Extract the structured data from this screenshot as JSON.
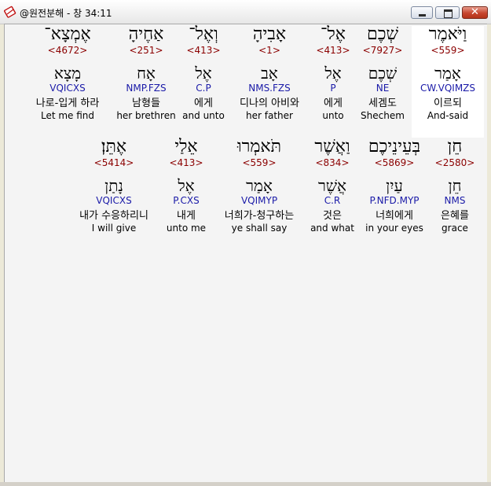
{
  "window": {
    "title": "@원전분해 - 창 34:11",
    "close_glyph": "✕"
  },
  "rows": [
    {
      "words": [
        {
          "hebrew": "וַיֹּאמֶר",
          "strong": "<559>",
          "lemma": "אָמַר",
          "morph": "CW.VQIMZS",
          "korean": "이르되",
          "english": "And-said"
        },
        {
          "hebrew": "שְׁכֶם",
          "strong": "<7927>",
          "lemma": "שְׁכֶם",
          "morph": "NE",
          "korean": "세겜도",
          "english": "Shechem"
        },
        {
          "hebrew": "אֶל־",
          "strong": "<413>",
          "lemma": "אֶל",
          "morph": "P",
          "korean": "에게",
          "english": "unto"
        },
        {
          "hebrew": "אָבִיהָ",
          "strong": "<1>",
          "lemma": "אָב",
          "morph": "NMS.FZS",
          "korean": "디나의 아비와",
          "english": "her father"
        },
        {
          "hebrew": "וְאֶל־",
          "strong": "<413>",
          "lemma": "אֶל",
          "morph": "C.P",
          "korean": "에게",
          "english": "and unto"
        },
        {
          "hebrew": "אַחֶיהָ",
          "strong": "<251>",
          "lemma": "אָח",
          "morph": "NMP.FZS",
          "korean": "남형들",
          "english": "her brethren"
        },
        {
          "hebrew": "אֶמְצָא־",
          "strong": "<4672>",
          "lemma": "מָצָא",
          "morph": "VQICXS",
          "korean": "나로-입게 하라",
          "english": "Let me find"
        }
      ]
    },
    {
      "words": [
        {
          "hebrew": "חֵן",
          "strong": "<2580>",
          "lemma": "חֵן",
          "morph": "NMS",
          "korean": "은혜를",
          "english": "grace"
        },
        {
          "hebrew": "בְּעֵינֵיכֶם",
          "strong": "<5869>",
          "lemma": "עַיִן",
          "morph": "P.NFD.MYP",
          "korean": "너희에게",
          "english": "in your eyes"
        },
        {
          "hebrew": "וַאֲשֶׁר",
          "strong": "<834>",
          "lemma": "אֲשֶׁר",
          "morph": "C.R",
          "korean": "것은",
          "english": "and what"
        },
        {
          "hebrew": "תֹּאמְרוּ",
          "strong": "<559>",
          "lemma": "אָמַר",
          "morph": "VQIMYP",
          "korean": "너희가-청구하는",
          "english": "ye shall say"
        },
        {
          "hebrew": "אֵלַי",
          "strong": "<413>",
          "lemma": "אֶל",
          "morph": "P.CXS",
          "korean": "내게",
          "english": "unto me"
        },
        {
          "hebrew": "אֶתֵּן׃",
          "strong": "<5414>",
          "lemma": "נָתַן",
          "morph": "VQICXS",
          "korean": "내가 수응하리니",
          "english": "I will give"
        }
      ]
    }
  ]
}
